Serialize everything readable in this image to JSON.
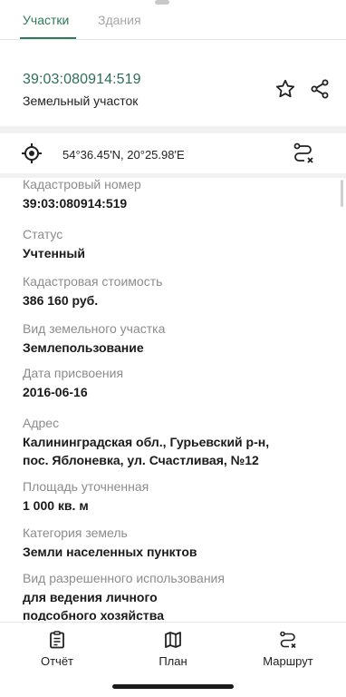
{
  "tabs": [
    {
      "label": "Участки",
      "active": true
    },
    {
      "label": "Здания",
      "active": false
    }
  ],
  "header": {
    "cadastral_number": "39:03:080914:519",
    "object_type": "Земельный участок"
  },
  "coordinates": "54°36.45'N, 20°25.98'E",
  "fields": [
    {
      "label": "Кадастровый номер",
      "value": "39:03:080914:519"
    },
    {
      "label": "Статус",
      "value": "Учтенный"
    },
    {
      "label": "Кадастровая стоимость",
      "value": "386 160 руб."
    },
    {
      "label": "Вид земельного участка",
      "value": "Землепользование"
    },
    {
      "label": "Дата присвоения",
      "value": "2016-06-16"
    },
    {
      "label": "Адрес",
      "value_lines": [
        "Калининградская обл., Гурьевский р-н,",
        "пос. Яблоневка, ул. Счастливая, №12"
      ]
    },
    {
      "label": "Площадь уточненная",
      "value": "1 000 кв. м"
    },
    {
      "label": "Категория земель",
      "value": "Земли населенных пунктов"
    },
    {
      "label": "Вид разрешенного использования",
      "value_lines": [
        "для ведения личного",
        "подсобного хозяйства"
      ]
    }
  ],
  "bottom_nav": [
    {
      "label": "Отчёт",
      "icon": "report-icon"
    },
    {
      "label": "План",
      "icon": "map-icon"
    },
    {
      "label": "Маршрут",
      "icon": "route-icon"
    }
  ],
  "colors": {
    "accent": "#2f7a5b",
    "id_text": "#2d6e56",
    "label_gray": "#8c8c8c"
  }
}
